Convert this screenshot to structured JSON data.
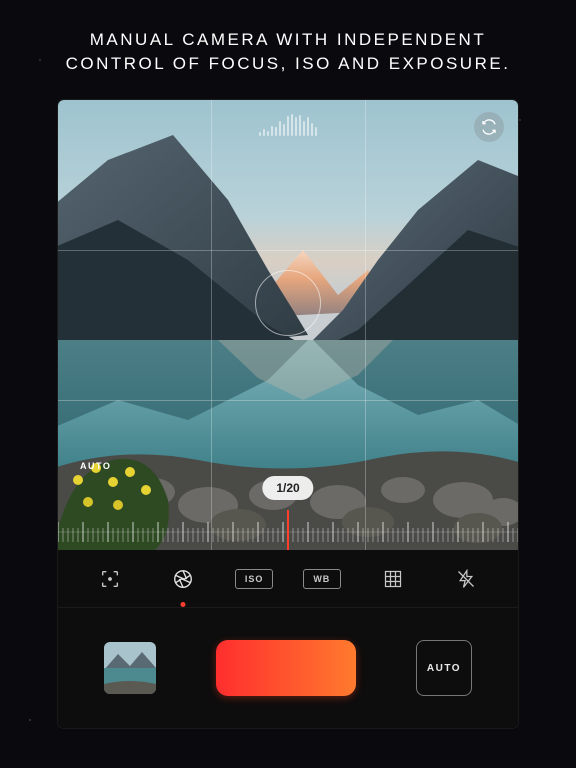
{
  "headline": {
    "line1": "MANUAL CAMERA WITH INDEPENDENT",
    "line2": "CONTROL OF FOCUS, ISO AND EXPOSURE."
  },
  "viewfinder": {
    "auto_badge": "AUTO",
    "shutter_value": "1/20",
    "icons": {
      "switch_camera": "switch-camera-icon"
    }
  },
  "toolbar": {
    "focus": {
      "name": "focus-icon"
    },
    "shutter": {
      "name": "aperture-icon",
      "active": true
    },
    "iso": {
      "label": "ISO"
    },
    "wb": {
      "label": "WB"
    },
    "grid": {
      "name": "grid-icon"
    },
    "flash": {
      "name": "flash-off-icon"
    }
  },
  "bottombar": {
    "thumbnail": "last-capture-thumbnail",
    "record": "record-button",
    "auto_button": "AUTO"
  },
  "colors": {
    "accent": "#ff3e2e",
    "accent_gradient_end": "#ff7a2e"
  }
}
